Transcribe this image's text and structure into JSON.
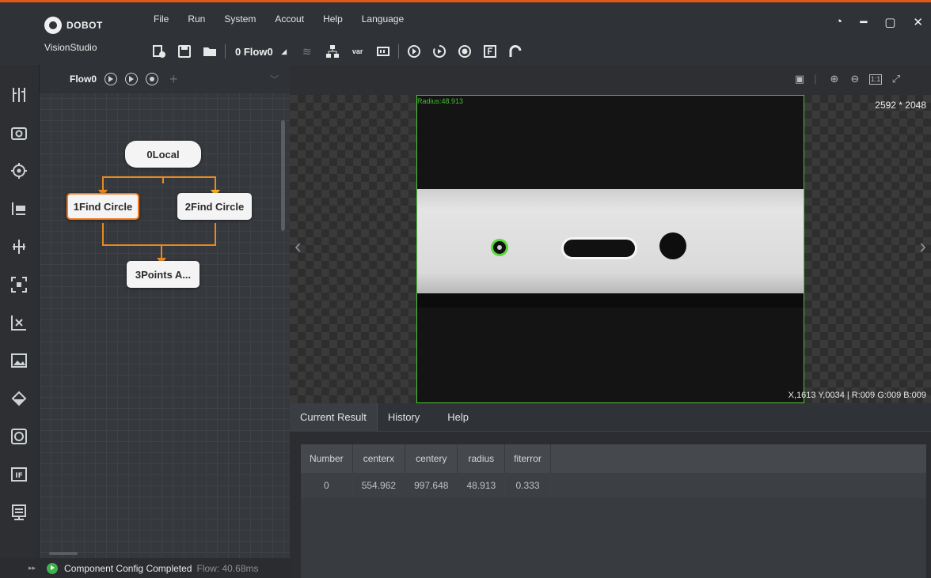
{
  "app": {
    "brand": "DOBOT",
    "name": "VisionStudio"
  },
  "menu": [
    "File",
    "Run",
    "System",
    "Accout",
    "Help",
    "Language"
  ],
  "toolbar": {
    "flow_select": "0 Flow0"
  },
  "flow_panel": {
    "tab_title": "Flow0",
    "nodes": [
      {
        "label": "0Local"
      },
      {
        "label": "1Find Circle"
      },
      {
        "label": "2Find Circle"
      },
      {
        "label": "3Points A..."
      }
    ]
  },
  "status": {
    "message": "Component Config Completed",
    "timing": "Flow: 40.68ms"
  },
  "viewer": {
    "dimensions": "2592 * 2048",
    "radius_label": "Radius:48.913",
    "pixel_info": "X,1613 Y,0034 | R:009 G:009 B:009"
  },
  "results": {
    "tabs": [
      "Current Result",
      "History",
      "Help"
    ],
    "columns": [
      "Number",
      "centerx",
      "centery",
      "radius",
      "fiterror"
    ],
    "rows": [
      [
        "0",
        "554.962",
        "997.648",
        "48.913",
        "0.333"
      ]
    ]
  },
  "colors": {
    "accent": "#e05a1c",
    "selected_node": "#f07a22",
    "detection": "#57d93a",
    "status_ok": "#3db24a"
  }
}
